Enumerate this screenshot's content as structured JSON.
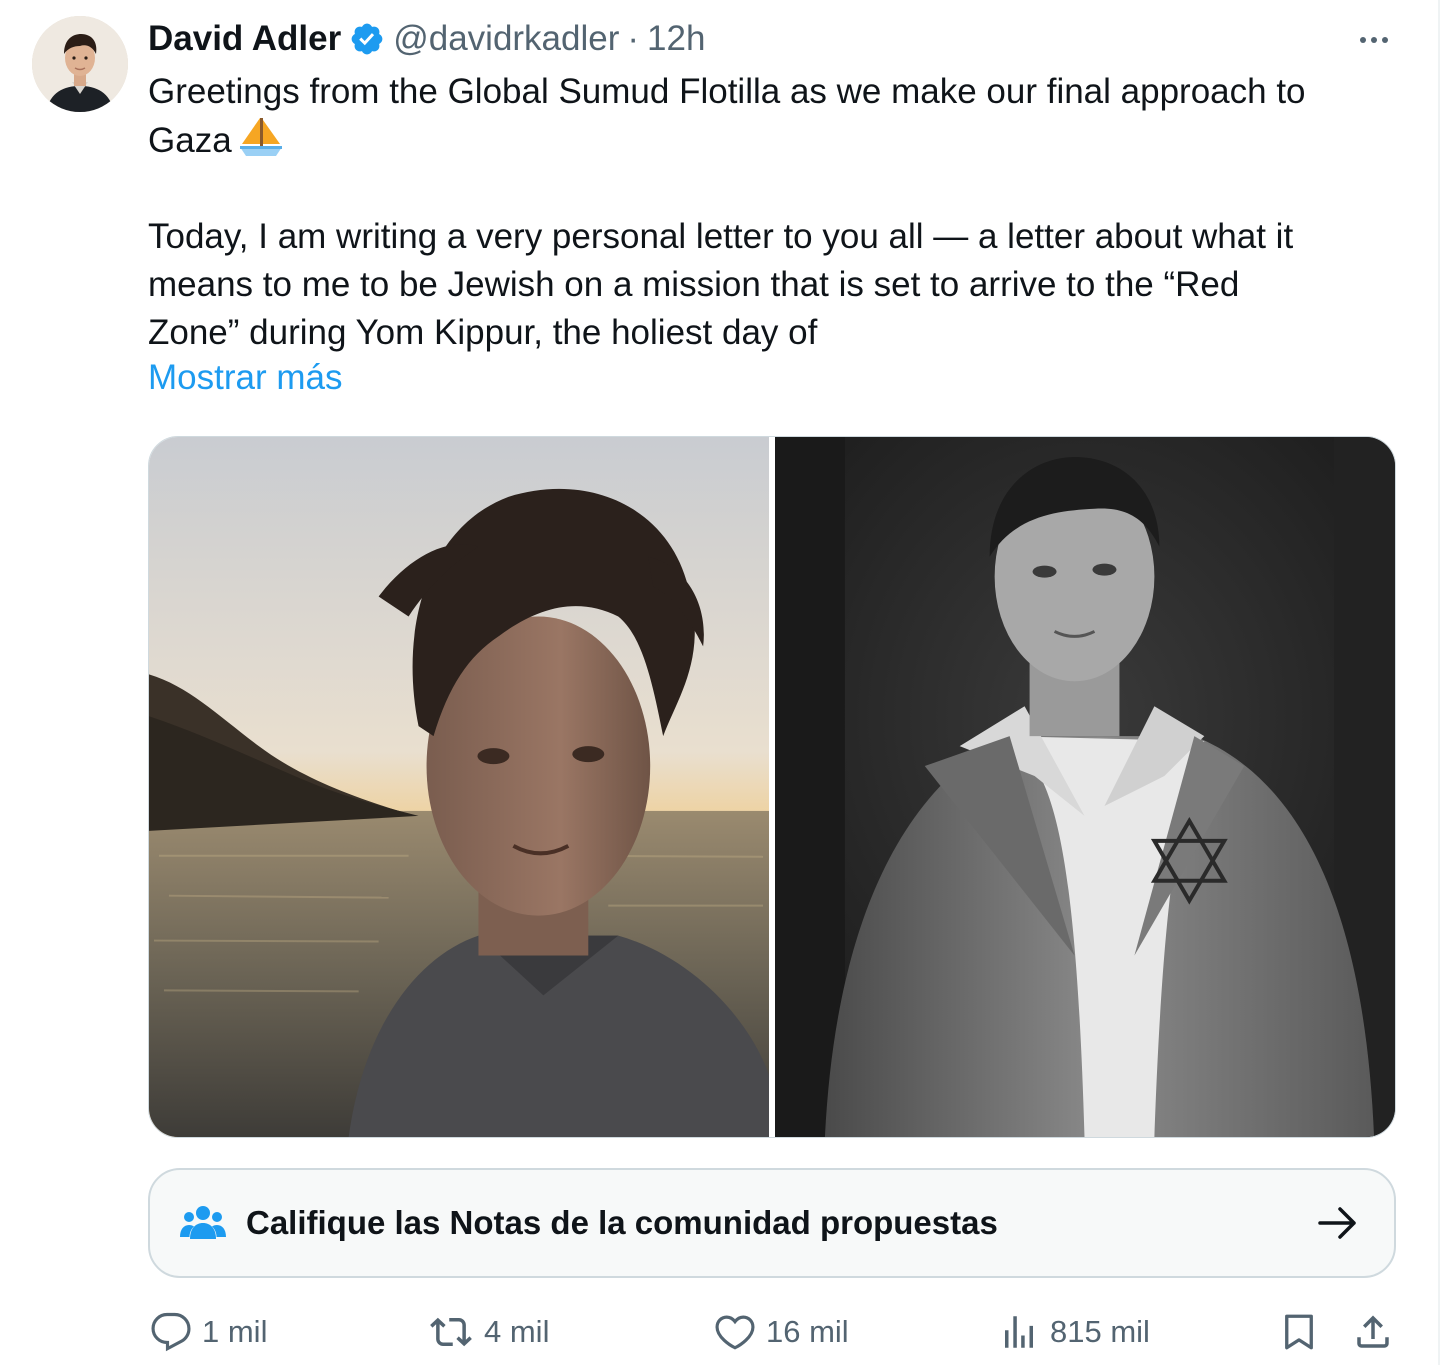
{
  "tweet": {
    "author": {
      "display_name": "David Adler",
      "handle": "@davidrkadler",
      "separator": "·",
      "time": "12h",
      "verified": true
    },
    "text": {
      "line_1": "Greetings from the Global Sumud Flotilla as we make our final approach to",
      "line_2": "Gaza",
      "line_3": "Today, I am writing a very personal letter to you all — a letter about what it",
      "line_4": "means to me to be Jewish on a mission that is set to arrive to the “Red",
      "line_5": "Zone” during Yom Kippur, the holiest day of"
    },
    "show_more_label": "Mostrar más",
    "media": [
      {
        "description_icon": "selfie-sunset-photo"
      },
      {
        "description_icon": "black-and-white-historical-photo"
      }
    ],
    "community_notes": {
      "label": "Califique las Notas de la comunidad propuestas"
    },
    "actions": {
      "replies": "1 mil",
      "reposts": "4 mil",
      "likes": "16 mil",
      "views": "815 mil"
    }
  },
  "colors": {
    "text": "#0f1419",
    "secondary": "#536471",
    "accent": "#1d9bf0",
    "border": "#cfd9de",
    "card_bg": "#f7f9f9"
  },
  "icons": {
    "verified": "verified-badge-icon",
    "more": "more-dots-icon",
    "boat": "sailboat-emoji-icon",
    "people": "people-icon",
    "arrow": "arrow-right-icon",
    "reply": "reply-icon",
    "repost": "repost-icon",
    "like": "heart-icon",
    "views": "views-chart-icon",
    "bookmark": "bookmark-icon",
    "share": "share-icon"
  }
}
